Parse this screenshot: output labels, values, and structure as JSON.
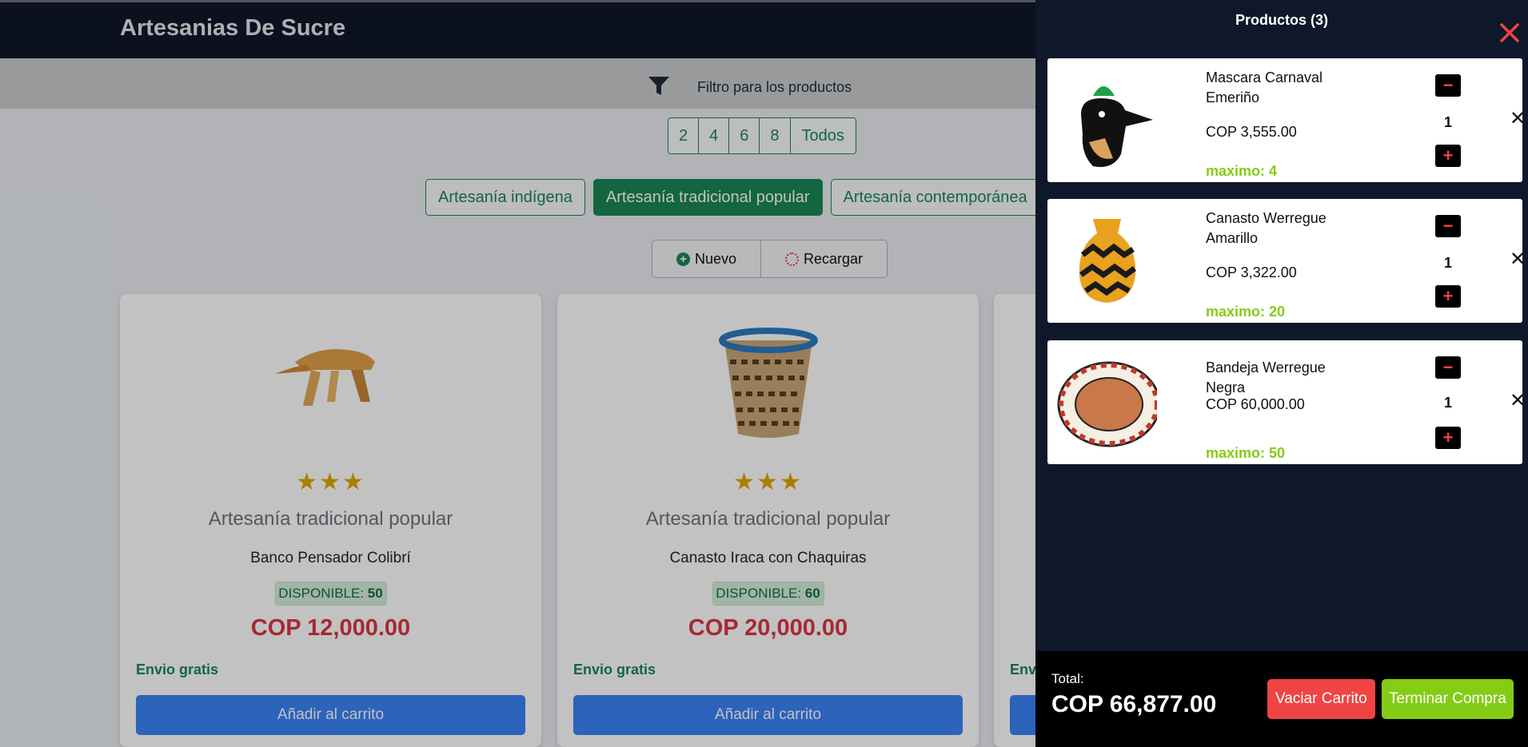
{
  "header": {
    "brand": "Artesanias De Sucre"
  },
  "filter": {
    "label": "Filtro para los productos",
    "icon": "filter-icon"
  },
  "pagination": {
    "options": [
      "2",
      "4",
      "6",
      "8",
      "Todos"
    ]
  },
  "categories": [
    {
      "label": "Artesanía indígena",
      "active": false
    },
    {
      "label": "Artesanía tradicional popular",
      "active": true
    },
    {
      "label": "Artesanía contemporánea",
      "active": false
    }
  ],
  "toolbar": {
    "new_label": "Nuevo",
    "reload_label": "Recargar"
  },
  "products": [
    {
      "stars": "★★★",
      "category": "Artesanía tradicional popular",
      "name": "Banco Pensador Colibrí",
      "stock_label": "DISPONIBLE:",
      "stock": "50",
      "price": "COP 12,000.00",
      "shipping": "Envio gratis",
      "add_label": "Añadir al carrito"
    },
    {
      "stars": "★★★",
      "category": "Artesanía tradicional popular",
      "name": "Canasto Iraca con Chaquiras",
      "stock_label": "DISPONIBLE:",
      "stock": "60",
      "price": "COP 20,000.00",
      "shipping": "Envio gratis",
      "add_label": "Añadir al carrito"
    },
    {
      "shipping": "Envi"
    }
  ],
  "cart": {
    "title": "Productos (3)",
    "items": [
      {
        "name": "Mascara Carnaval Emeriño",
        "price": "COP 3,555.00",
        "qty": "1",
        "max": "maximo: 4"
      },
      {
        "name": "Canasto Werregue Amarillo",
        "price": "COP 3,322.00",
        "qty": "1",
        "max": "maximo: 20"
      },
      {
        "name": "Bandeja Werregue Negra",
        "price": "COP 60,000.00",
        "qty": "1",
        "max": "maximo: 50"
      }
    ],
    "minus": "−",
    "plus": "+",
    "remove": "✕",
    "total_label": "Total:",
    "total": "COP 66,877.00",
    "empty_label": "Vaciar Carrito",
    "checkout_label": "Terminar Compra"
  },
  "colors": {
    "brand_green": "#198754",
    "price_red": "#dc3545",
    "header_bg": "#0f172a",
    "accent_lime": "#84cc16",
    "add_blue": "#3b82f6"
  }
}
